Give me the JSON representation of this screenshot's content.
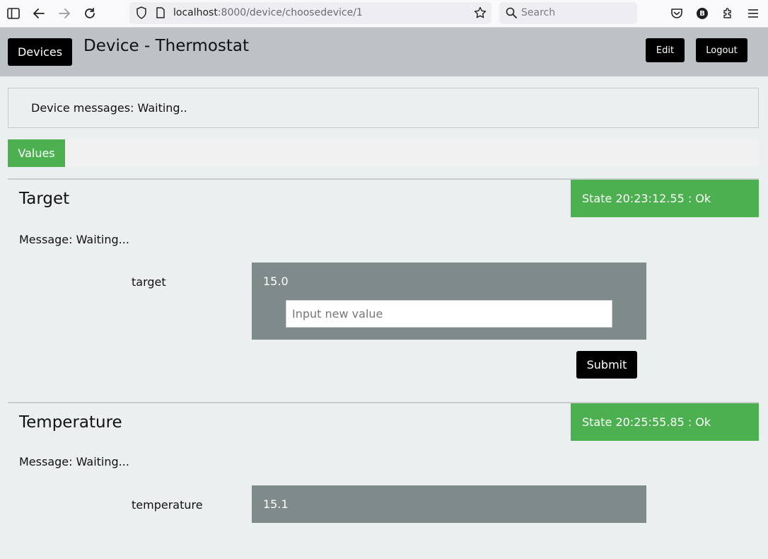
{
  "browser": {
    "url_host": "localhost",
    "url_rest": ":8000/device/choosedevice/1",
    "search_placeholder": "Search",
    "profile_initial": "B"
  },
  "header": {
    "devices_label": "Devices",
    "title": "Device - Thermostat",
    "edit_label": "Edit",
    "logout_label": "Logout"
  },
  "messages": {
    "text": "Device messages: Waiting.."
  },
  "tabs": [
    {
      "label": "Values",
      "active": true
    }
  ],
  "sections": [
    {
      "title": "Target",
      "state": "State 20:23:12.55 : Ok",
      "message": "Message: Waiting...",
      "value_label": "target",
      "current_value": "15.0",
      "input_placeholder": "Input new value",
      "submit_label": "Submit"
    },
    {
      "title": "Temperature",
      "state": "State 20:25:55.85 : Ok",
      "message": "Message: Waiting...",
      "value_label": "temperature",
      "current_value": "15.1"
    }
  ],
  "colors": {
    "accent_green": "#4caf50",
    "header_bg": "#bdc2c6",
    "value_panel": "#7f8b8b",
    "button_black": "#000000"
  },
  "icons": [
    "sidebar-icon",
    "back-icon",
    "forward-icon",
    "reload-icon",
    "shield-icon",
    "page-icon",
    "star-icon",
    "search-icon",
    "pocket-icon",
    "account-icon",
    "extensions-icon",
    "menu-icon"
  ]
}
